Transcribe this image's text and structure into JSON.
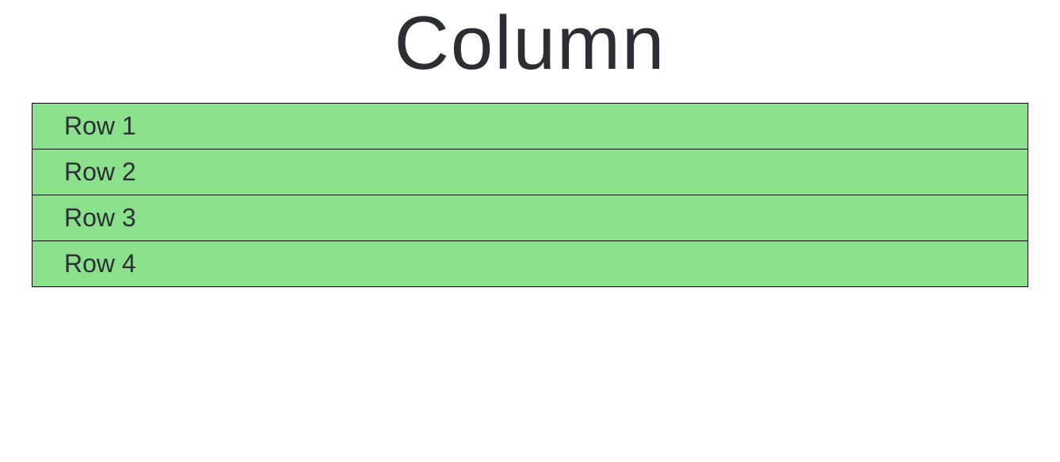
{
  "title": "Column",
  "rows": [
    "Row 1",
    "Row 2",
    "Row 3",
    "Row 4"
  ]
}
